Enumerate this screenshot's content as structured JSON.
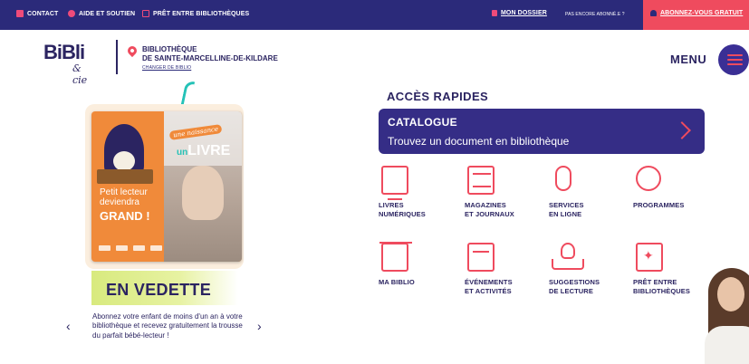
{
  "topbar": {
    "contact": "CONTACT",
    "aide": "AIDE ET SOUTIEN",
    "pret": "PRÊT ENTRE BIBLIOTHÈQUES",
    "dossier": "MON DOSSIER",
    "pas_abonne": "PAS ENCORE ABONNÉ.E ?",
    "abonnez": "ABONNEZ-VOUS GRATUIT",
    "accent": "#ef4b5e",
    "background": "#2b2a7a"
  },
  "header": {
    "logo": "BiBli",
    "logo_sub": "& cie",
    "library_line1": "BIBLIOTHÈQUE",
    "library_line2": "DE SAINTE-MARCELLINE-DE-KILDARE",
    "change_library": "CHANGER DE BIBLIO",
    "menu": "MENU"
  },
  "feature": {
    "card_tag": "une naissance",
    "card_livre": "LIVRE",
    "card_un": "un",
    "card_text_1": "Petit lecteur",
    "card_text_2": "deviendra",
    "card_text_3": "GRAND !",
    "title": "EN VEDETTE",
    "description": "Abonnez votre enfant de moins d'un an à votre bibliothèque et recevez gratuitement la trousse du parfait bébé-lecteur !",
    "prev": "‹",
    "next": "›"
  },
  "quick_access": {
    "title": "ACCÈS RAPIDES",
    "catalogue_title": "CATALOGUE",
    "catalogue_sub": "Trouvez un document en bibliothèque",
    "tiles": [
      {
        "line1": "LIVRES",
        "line2": "NUMÉRIQUES",
        "icon": "monitor-book-icon"
      },
      {
        "line1": "MAGAZINES",
        "line2": "ET JOURNAUX",
        "icon": "newspaper-icon"
      },
      {
        "line1": "SERVICES",
        "line2": "EN LIGNE",
        "icon": "mouse-icon"
      },
      {
        "line1": "PROGRAMMES",
        "line2": "",
        "icon": "people-icon"
      },
      {
        "line1": "MA BIBLIO",
        "line2": "",
        "icon": "building-icon"
      },
      {
        "line1": "ÉVÉNEMENTS",
        "line2": "ET ACTIVITÉS",
        "icon": "calendar-icon"
      },
      {
        "line1": "SUGGESTIONS",
        "line2": "DE LECTURE",
        "icon": "lightbulb-book-icon"
      },
      {
        "line1": "PRÊT ENTRE",
        "line2": "BIBLIOTHÈQUES",
        "icon": "book-star-icon"
      }
    ]
  }
}
